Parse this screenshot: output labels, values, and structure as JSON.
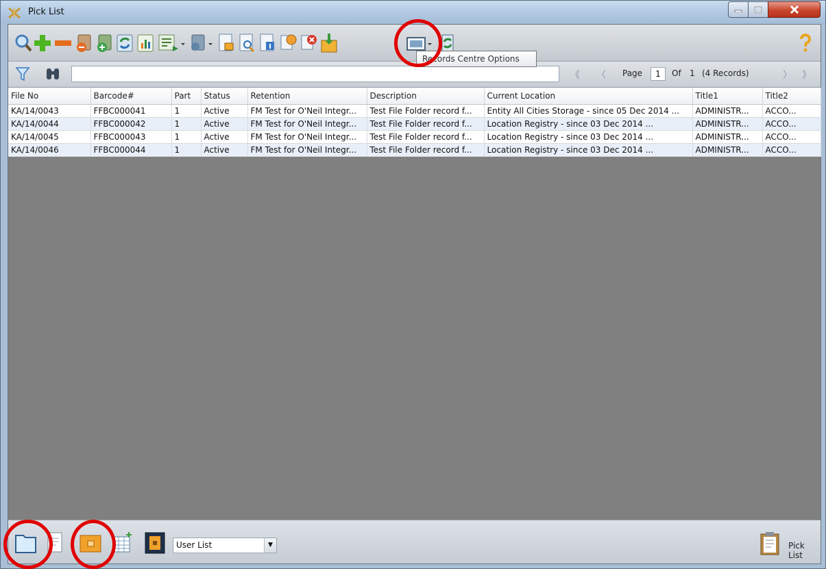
{
  "window": {
    "title": "Pick List",
    "accent": "#e00000"
  },
  "toolbar": {
    "icons": [
      "search-icon",
      "add-icon",
      "remove-icon",
      "file-minus-icon",
      "file-add-icon",
      "refresh-icon",
      "chart-icon",
      "export-icon",
      "file-dropdown-icon",
      "document-lock-icon",
      "document-search-icon",
      "document-info-icon",
      "copy-icon",
      "delete-icon",
      "import-icon",
      "records-centre-options-icon",
      "sync-icon",
      "help-icon"
    ]
  },
  "searchbar": {
    "search_value": "",
    "page_label": "Page",
    "page_value": "1",
    "of_label": "Of",
    "of_value": "1",
    "records_label": "(4 Records)"
  },
  "tooltip": {
    "text": "Records Centre Options"
  },
  "table": {
    "headers": [
      "File No",
      "Barcode#",
      "Part",
      "Status",
      "Retention",
      "Description",
      "Current Location",
      "Title1",
      "Title2"
    ],
    "rows": [
      [
        "KA/14/0043",
        "FFBC000041",
        "1",
        "Active",
        "FM Test for O'Neil Integr...",
        "Test File Folder record f...",
        "Entity All Cities Storage - since 05 Dec 2014 ...",
        "ADMINISTR...",
        "ACCO..."
      ],
      [
        "KA/14/0044",
        "FFBC000042",
        "1",
        "Active",
        "FM Test for O'Neil Integr...",
        "Test File Folder record f...",
        "Location Registry - since 03 Dec 2014          ...",
        "ADMINISTR...",
        "ACCO..."
      ],
      [
        "KA/14/0045",
        "FFBC000043",
        "1",
        "Active",
        "FM Test for O'Neil Integr...",
        "Test File Folder record f...",
        "Location Registry - since 03 Dec 2014          ...",
        "ADMINISTR...",
        "ACCO..."
      ],
      [
        "KA/14/0046",
        "FFBC000044",
        "1",
        "Active",
        "FM Test for O'Neil Integr...",
        "Test File Folder record f...",
        "Location Registry - since 03 Dec 2014          ...",
        "ADMINISTR...",
        "ACCO..."
      ]
    ]
  },
  "statusbar": {
    "user_list_value": "User List",
    "pick_list_label": "Pick List"
  }
}
